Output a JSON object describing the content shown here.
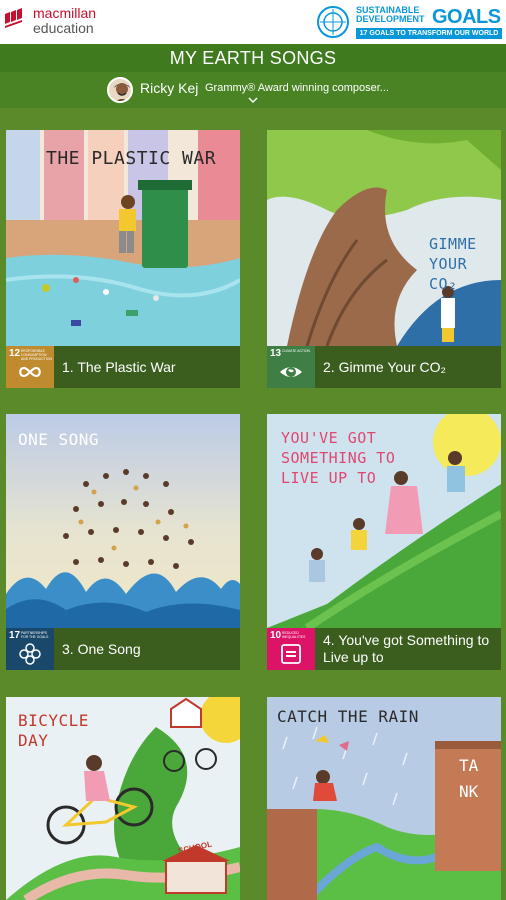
{
  "brand": {
    "line1": "macmillan",
    "line2": "education"
  },
  "sdg": {
    "line1": "SUSTAINABLE",
    "line2": "DEVELOPMENT",
    "goals": "GOALS",
    "subtitle": "17 GOALS TO TRANSFORM OUR WORLD"
  },
  "header": {
    "title": "MY EARTH SONGS",
    "artist_name": "Ricky Kej",
    "artist_desc": "Grammy® Award winning composer..."
  },
  "songs": [
    {
      "label": "1. The Plastic War",
      "art_title": "THE PLASTIC WAR",
      "sdg_number": "12",
      "sdg_label": "RESPONSIBLE CONSUMPTION AND PRODUCTION",
      "sdg_color": "#bf8b2e"
    },
    {
      "label": "2. Gimme Your CO₂",
      "art_title": "GIMME YOUR CO₂",
      "sdg_number": "13",
      "sdg_label": "CLIMATE ACTION",
      "sdg_color": "#3f7e44"
    },
    {
      "label": "3. One Song",
      "art_title": "ONE SONG",
      "sdg_number": "17",
      "sdg_label": "PARTNERSHIPS FOR THE GOALS",
      "sdg_color": "#19486a"
    },
    {
      "label": "4. You've got Something to Live up to",
      "art_title": "YOU'VE GOT SOMETHING TO LIVE UP TO",
      "sdg_number": "10",
      "sdg_label": "REDUCED INEQUALITIES",
      "sdg_color": "#dd1367"
    },
    {
      "art_title": "BICYCLE DAY",
      "school_sign": "SCHOOL"
    },
    {
      "art_title": "CATCH THE RAIN",
      "tank_label": "TANK"
    }
  ],
  "colors": {
    "background": "#5b8a2a",
    "title_bar": "#3f7a1f",
    "caption": "#3b5e1f",
    "brand_red": "#c8102e",
    "sdg_blue": "#0a97d9"
  }
}
